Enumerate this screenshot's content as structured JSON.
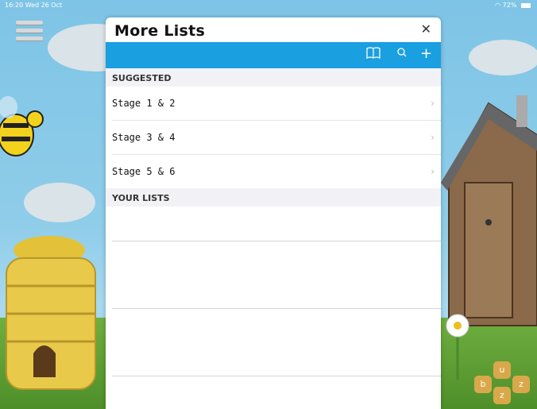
{
  "status": {
    "time_date": "16:20  Wed 26 Oct",
    "battery": "72%"
  },
  "modal": {
    "title": "More Lists",
    "close": "✕",
    "toolbar": {
      "book_icon": "book-icon",
      "search_icon": "search-icon",
      "add_icon": "plus-icon"
    },
    "suggested_header": "SUGGESTED",
    "suggested_items": [
      "Stage 1 & 2",
      "Stage 3 & 4",
      "Stage 5 & 6"
    ],
    "your_lists_header": "YOUR LISTS"
  },
  "game": {
    "hex_letters": [
      "u",
      "b",
      "z",
      "z"
    ]
  }
}
